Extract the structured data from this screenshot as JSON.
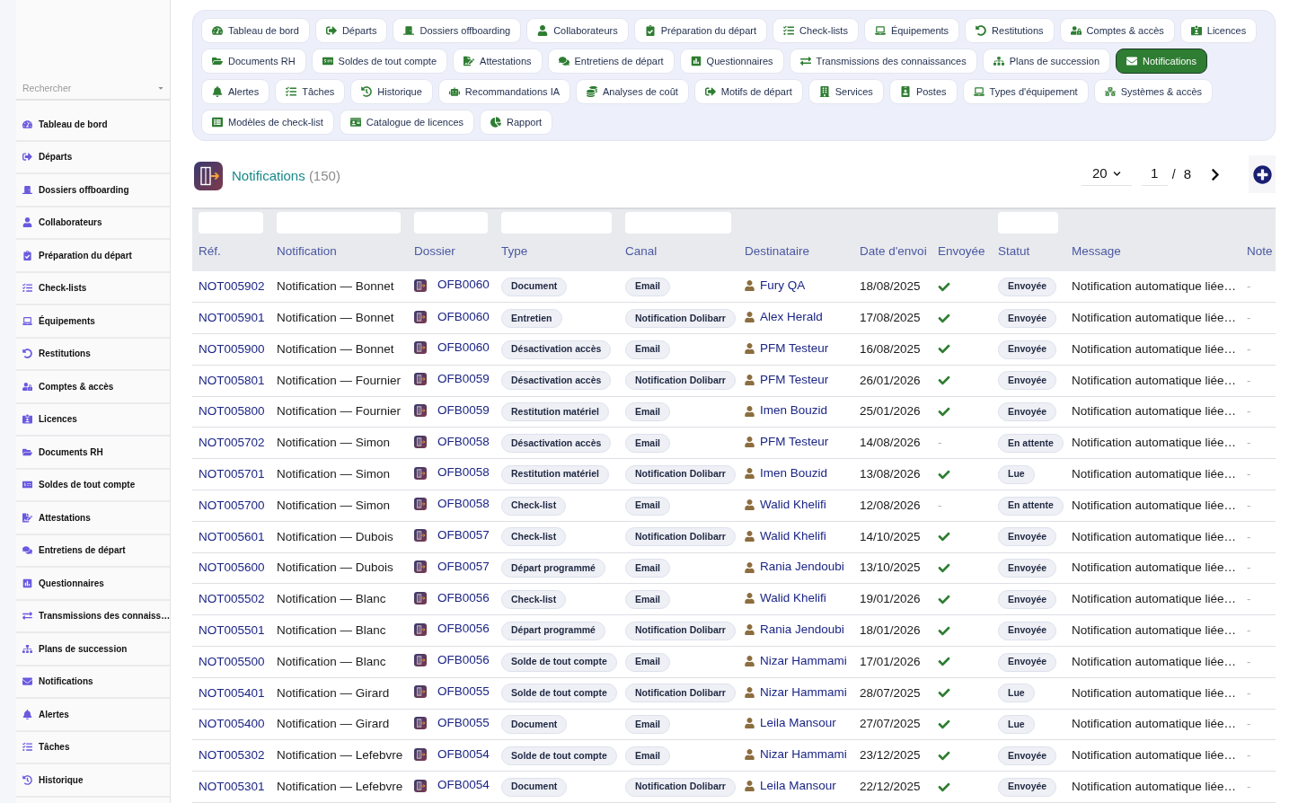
{
  "sidebar": {
    "search": {
      "placeholder": "Rechercher"
    },
    "items": [
      {
        "label": "Tableau de bord"
      },
      {
        "label": "Départs"
      },
      {
        "label": "Dossiers offboarding"
      },
      {
        "label": "Collaborateurs"
      },
      {
        "label": "Préparation du départ"
      },
      {
        "label": "Check-lists"
      },
      {
        "label": "Équipements"
      },
      {
        "label": "Restitutions"
      },
      {
        "label": "Comptes & accès"
      },
      {
        "label": "Licences"
      },
      {
        "label": "Documents RH"
      },
      {
        "label": "Soldes de tout compte"
      },
      {
        "label": "Attestations"
      },
      {
        "label": "Entretiens de départ"
      },
      {
        "label": "Questionnaires"
      },
      {
        "label": "Transmissions des connaiss…"
      },
      {
        "label": "Plans de succession"
      },
      {
        "label": "Notifications"
      },
      {
        "label": "Alertes"
      },
      {
        "label": "Tâches"
      },
      {
        "label": "Historique"
      }
    ]
  },
  "nav_tabs": [
    {
      "label": "Tableau de bord",
      "selected": false
    },
    {
      "label": "Départs",
      "selected": false
    },
    {
      "label": "Dossiers offboarding",
      "selected": false
    },
    {
      "label": "Collaborateurs",
      "selected": false
    },
    {
      "label": "Préparation du départ",
      "selected": false
    },
    {
      "label": "Check-lists",
      "selected": false
    },
    {
      "label": "Équipements",
      "selected": false
    },
    {
      "label": "Restitutions",
      "selected": false
    },
    {
      "label": "Comptes & accès",
      "selected": false
    },
    {
      "label": "Licences",
      "selected": false
    },
    {
      "label": "Documents RH",
      "selected": false
    },
    {
      "label": "Soldes de tout compte",
      "selected": false
    },
    {
      "label": "Attestations",
      "selected": false
    },
    {
      "label": "Entretiens de départ",
      "selected": false
    },
    {
      "label": "Questionnaires",
      "selected": false
    },
    {
      "label": "Transmissions des connaissances",
      "selected": false
    },
    {
      "label": "Plans de succession",
      "selected": false
    },
    {
      "label": "Notifications",
      "selected": true
    },
    {
      "label": "Alertes",
      "selected": false
    },
    {
      "label": "Tâches",
      "selected": false
    },
    {
      "label": "Historique",
      "selected": false
    },
    {
      "label": "Recommandations IA",
      "selected": false
    },
    {
      "label": "Analyses de coût",
      "selected": false
    },
    {
      "label": "Motifs de départ",
      "selected": false
    },
    {
      "label": "Services",
      "selected": false
    },
    {
      "label": "Postes",
      "selected": false
    },
    {
      "label": "Types d'équipement",
      "selected": false
    },
    {
      "label": "Systèmes & accès",
      "selected": false
    },
    {
      "label": "Modèles de check-list",
      "selected": false
    },
    {
      "label": "Catalogue de licences",
      "selected": false
    },
    {
      "label": "Rapport",
      "selected": false
    }
  ],
  "page_header": {
    "title": "Notifications",
    "count": "(150)"
  },
  "pagination": {
    "page_size": "20",
    "page": "1",
    "separator": "/",
    "total_pages": "8"
  },
  "table": {
    "columns": [
      {
        "label": "Réf.",
        "filterable": true
      },
      {
        "label": "Notification",
        "filterable": true
      },
      {
        "label": "Dossier",
        "filterable": true
      },
      {
        "label": "Type",
        "filterable": true
      },
      {
        "label": "Canal",
        "filterable": true
      },
      {
        "label": "Destinataire",
        "filterable": false
      },
      {
        "label": "Date d'envoi",
        "filterable": false
      },
      {
        "label": "Envoyée",
        "filterable": false
      },
      {
        "label": "Statut",
        "filterable": true
      },
      {
        "label": "Message",
        "filterable": false
      },
      {
        "label": "Note",
        "filterable": false
      }
    ],
    "rows": [
      {
        "ref": "NOT005902",
        "notification": "Notification — Bonnet",
        "dossier": "OFB0060",
        "type": "Document",
        "canal": "Email",
        "destinataire": "Fury QA",
        "date": "18/08/2025",
        "sent": true,
        "statut": "Envoyée",
        "message": "Notification automatique liée…",
        "note": "-"
      },
      {
        "ref": "NOT005901",
        "notification": "Notification — Bonnet",
        "dossier": "OFB0060",
        "type": "Entretien",
        "canal": "Notification Dolibarr",
        "destinataire": "Alex Herald",
        "date": "17/08/2025",
        "sent": true,
        "statut": "Envoyée",
        "message": "Notification automatique liée…",
        "note": "-"
      },
      {
        "ref": "NOT005900",
        "notification": "Notification — Bonnet",
        "dossier": "OFB0060",
        "type": "Désactivation accès",
        "canal": "Email",
        "destinataire": "PFM Testeur",
        "date": "16/08/2025",
        "sent": true,
        "statut": "Envoyée",
        "message": "Notification automatique liée…",
        "note": "-"
      },
      {
        "ref": "NOT005801",
        "notification": "Notification — Fournier",
        "dossier": "OFB0059",
        "type": "Désactivation accès",
        "canal": "Notification Dolibarr",
        "destinataire": "PFM Testeur",
        "date": "26/01/2026",
        "sent": true,
        "statut": "Envoyée",
        "message": "Notification automatique liée…",
        "note": "-"
      },
      {
        "ref": "NOT005800",
        "notification": "Notification — Fournier",
        "dossier": "OFB0059",
        "type": "Restitution matériel",
        "canal": "Email",
        "destinataire": "Imen Bouzid",
        "date": "25/01/2026",
        "sent": true,
        "statut": "Envoyée",
        "message": "Notification automatique liée…",
        "note": "-"
      },
      {
        "ref": "NOT005702",
        "notification": "Notification — Simon",
        "dossier": "OFB0058",
        "type": "Désactivation accès",
        "canal": "Email",
        "destinataire": "PFM Testeur",
        "date": "14/08/2026",
        "sent": false,
        "sent_text": "-",
        "statut": "En attente",
        "message": "Notification automatique liée…",
        "note": "-"
      },
      {
        "ref": "NOT005701",
        "notification": "Notification — Simon",
        "dossier": "OFB0058",
        "type": "Restitution matériel",
        "canal": "Notification Dolibarr",
        "destinataire": "Imen Bouzid",
        "date": "13/08/2026",
        "sent": true,
        "statut": "Lue",
        "message": "Notification automatique liée…",
        "note": "-"
      },
      {
        "ref": "NOT005700",
        "notification": "Notification — Simon",
        "dossier": "OFB0058",
        "type": "Check-list",
        "canal": "Email",
        "destinataire": "Walid Khelifi",
        "date": "12/08/2026",
        "sent": false,
        "sent_text": "-",
        "statut": "En attente",
        "message": "Notification automatique liée…",
        "note": "-"
      },
      {
        "ref": "NOT005601",
        "notification": "Notification — Dubois",
        "dossier": "OFB0057",
        "type": "Check-list",
        "canal": "Notification Dolibarr",
        "destinataire": "Walid Khelifi",
        "date": "14/10/2025",
        "sent": true,
        "statut": "Envoyée",
        "message": "Notification automatique liée…",
        "note": "-"
      },
      {
        "ref": "NOT005600",
        "notification": "Notification — Dubois",
        "dossier": "OFB0057",
        "type": "Départ programmé",
        "canal": "Email",
        "destinataire": "Rania Jendoubi",
        "date": "13/10/2025",
        "sent": true,
        "statut": "Envoyée",
        "message": "Notification automatique liée…",
        "note": "-"
      },
      {
        "ref": "NOT005502",
        "notification": "Notification — Blanc",
        "dossier": "OFB0056",
        "type": "Check-list",
        "canal": "Email",
        "destinataire": "Walid Khelifi",
        "date": "19/01/2026",
        "sent": true,
        "statut": "Envoyée",
        "message": "Notification automatique liée…",
        "note": "-"
      },
      {
        "ref": "NOT005501",
        "notification": "Notification — Blanc",
        "dossier": "OFB0056",
        "type": "Départ programmé",
        "canal": "Notification Dolibarr",
        "destinataire": "Rania Jendoubi",
        "date": "18/01/2026",
        "sent": true,
        "statut": "Envoyée",
        "message": "Notification automatique liée…",
        "note": "-"
      },
      {
        "ref": "NOT005500",
        "notification": "Notification — Blanc",
        "dossier": "OFB0056",
        "type": "Solde de tout compte",
        "canal": "Email",
        "destinataire": "Nizar Hammami",
        "date": "17/01/2026",
        "sent": true,
        "statut": "Envoyée",
        "message": "Notification automatique liée…",
        "note": "-"
      },
      {
        "ref": "NOT005401",
        "notification": "Notification — Girard",
        "dossier": "OFB0055",
        "type": "Solde de tout compte",
        "canal": "Notification Dolibarr",
        "destinataire": "Nizar Hammami",
        "date": "28/07/2025",
        "sent": true,
        "statut": "Lue",
        "message": "Notification automatique liée…",
        "note": "-"
      },
      {
        "ref": "NOT005400",
        "notification": "Notification — Girard",
        "dossier": "OFB0055",
        "type": "Document",
        "canal": "Email",
        "destinataire": "Leila Mansour",
        "date": "27/07/2025",
        "sent": true,
        "statut": "Lue",
        "message": "Notification automatique liée…",
        "note": "-"
      },
      {
        "ref": "NOT005302",
        "notification": "Notification — Lefebvre",
        "dossier": "OFB0054",
        "type": "Solde de tout compte",
        "canal": "Email",
        "destinataire": "Nizar Hammami",
        "date": "23/12/2025",
        "sent": true,
        "statut": "Envoyée",
        "message": "Notification automatique liée…",
        "note": "-"
      },
      {
        "ref": "NOT005301",
        "notification": "Notification — Lefebvre",
        "dossier": "OFB0054",
        "type": "Document",
        "canal": "Notification Dolibarr",
        "destinataire": "Leila Mansour",
        "date": "22/12/2025",
        "sent": true,
        "statut": "Envoyée",
        "message": "Notification automatique liée…",
        "note": "-"
      }
    ]
  }
}
